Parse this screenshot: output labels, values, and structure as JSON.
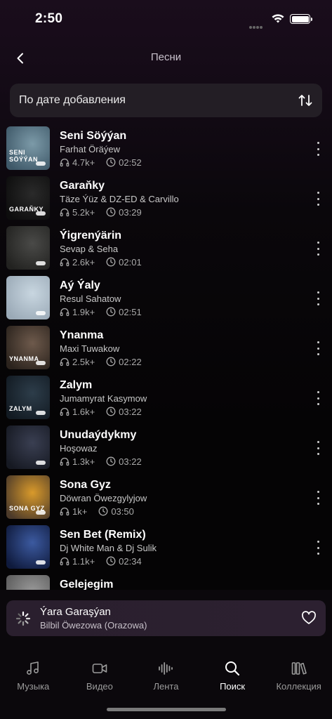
{
  "status_bar": {
    "time": "2:50"
  },
  "header": {
    "title": "Песни"
  },
  "sort": {
    "label": "По дате добавления"
  },
  "songs": [
    {
      "title": "Seni Söýýan",
      "artist": "Farhat Öräýew",
      "listens": "4.7k+",
      "duration": "02:52",
      "cover_text": "SENI SÖÝÝAN",
      "cover_colors": [
        "#7c9aa8",
        "#3e5868"
      ]
    },
    {
      "title": "Garaňky",
      "artist": "Täze Ýüz  & DZ-ED  & Carvillo",
      "listens": "5.2k+",
      "duration": "03:29",
      "cover_text": "GARAŇKY",
      "cover_colors": [
        "#2a2a2a",
        "#0d0d0d"
      ]
    },
    {
      "title": "Ýigrenýärin",
      "artist": "Sevap  & Seha",
      "listens": "2.6k+",
      "duration": "02:01",
      "cover_text": "",
      "cover_colors": [
        "#4a4a48",
        "#222220"
      ]
    },
    {
      "title": "Aý Ýaly",
      "artist": "Resul Sahatow",
      "listens": "1.9k+",
      "duration": "02:51",
      "cover_text": "",
      "cover_colors": [
        "#c8d6e0",
        "#9aa9b6"
      ]
    },
    {
      "title": "Ynanma",
      "artist": "Maxi Tuwakow",
      "listens": "2.5k+",
      "duration": "02:22",
      "cover_text": "YNANMA",
      "cover_colors": [
        "#6e5a4c",
        "#2b231d"
      ]
    },
    {
      "title": "Zalym",
      "artist": "Jumamyrat Kasymow",
      "listens": "1.6k+",
      "duration": "03:22",
      "cover_text": "ZALYM",
      "cover_colors": [
        "#2d3d4a",
        "#121a22"
      ]
    },
    {
      "title": "Unudaýdykmy",
      "artist": "Hoşowaz",
      "listens": "1.3k+",
      "duration": "03:22",
      "cover_text": "",
      "cover_colors": [
        "#3a3f52",
        "#161922"
      ]
    },
    {
      "title": "Sona Gyz",
      "artist": "Döwran Öwezgylyjow",
      "listens": "1k+",
      "duration": "03:50",
      "cover_text": "SONA GYZ",
      "cover_colors": [
        "#d99a2b",
        "#4c3a2a"
      ]
    },
    {
      "title": "Sen Bet (Remix)",
      "artist": "Dj White Man & Dj Sulik",
      "listens": "1.1k+",
      "duration": "02:34",
      "cover_text": "",
      "cover_colors": [
        "#3c5aa0",
        "#0f1a3c"
      ]
    },
    {
      "title": "Gelejegim",
      "artist": "",
      "listens": "",
      "duration": "",
      "cover_text": "",
      "cover_colors": [
        "#9a9a9a",
        "#5a5a5a"
      ]
    }
  ],
  "mini_player": {
    "title": "Ýara Garaşýan",
    "artist": "Bilbil Öwezowa (Orazowa)"
  },
  "tabs": [
    {
      "label": "Музыка",
      "icon": "music-note-icon",
      "active": false
    },
    {
      "label": "Видео",
      "icon": "video-camera-icon",
      "active": false
    },
    {
      "label": "Лента",
      "icon": "waveform-icon",
      "active": false
    },
    {
      "label": "Поиск",
      "icon": "search-icon",
      "active": true
    },
    {
      "label": "Коллекция",
      "icon": "library-icon",
      "active": false
    }
  ],
  "colors": {
    "background": "#050405",
    "sort_bar": "#231e25",
    "mini_player": "#2a1f2e",
    "active_tab": "#ffffff",
    "inactive_tab": "#9b9b9b"
  }
}
